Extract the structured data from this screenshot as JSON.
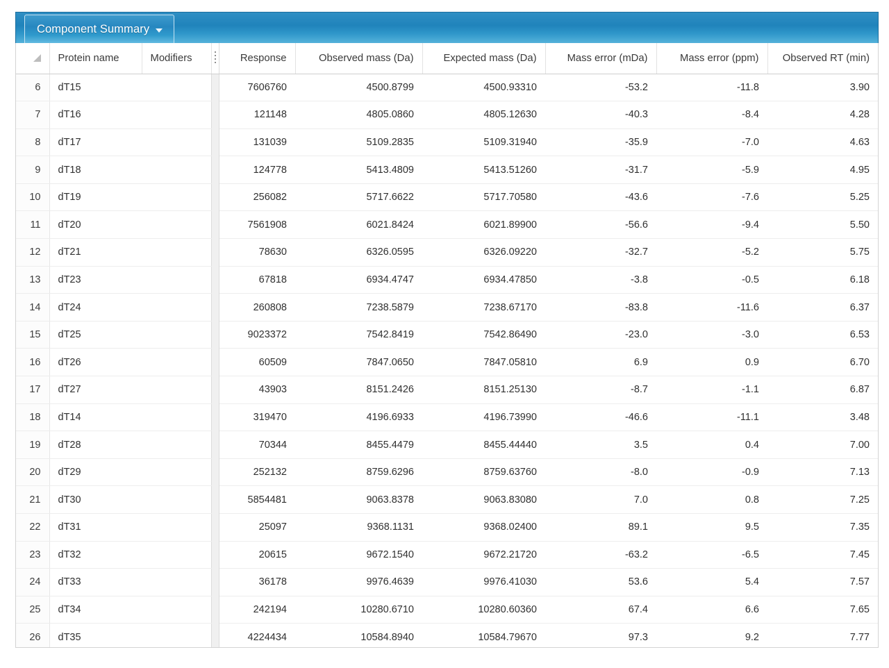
{
  "tab": {
    "label": "Component Summary",
    "caret_icon": "chevron-down-icon"
  },
  "grid": {
    "corner_icon": "select-all-triangle-icon",
    "splitter_icon": "column-grip-icon",
    "columns": [
      "Protein name",
      "Modifiers",
      "Response",
      "Observed mass (Da)",
      "Expected mass (Da)",
      "Mass error (mDa)",
      "Mass error (ppm)",
      "Observed RT (min)"
    ],
    "rows": [
      {
        "n": "6",
        "protein": "dT15",
        "mods": "",
        "response": "7606760",
        "observed": "4500.8799",
        "expected": "4500.93310",
        "mda": "-53.2",
        "ppm": "-11.8",
        "rt": "3.90"
      },
      {
        "n": "7",
        "protein": "dT16",
        "mods": "",
        "response": "121148",
        "observed": "4805.0860",
        "expected": "4805.12630",
        "mda": "-40.3",
        "ppm": "-8.4",
        "rt": "4.28"
      },
      {
        "n": "8",
        "protein": "dT17",
        "mods": "",
        "response": "131039",
        "observed": "5109.2835",
        "expected": "5109.31940",
        "mda": "-35.9",
        "ppm": "-7.0",
        "rt": "4.63"
      },
      {
        "n": "9",
        "protein": "dT18",
        "mods": "",
        "response": "124778",
        "observed": "5413.4809",
        "expected": "5413.51260",
        "mda": "-31.7",
        "ppm": "-5.9",
        "rt": "4.95"
      },
      {
        "n": "10",
        "protein": "dT19",
        "mods": "",
        "response": "256082",
        "observed": "5717.6622",
        "expected": "5717.70580",
        "mda": "-43.6",
        "ppm": "-7.6",
        "rt": "5.25"
      },
      {
        "n": "11",
        "protein": "dT20",
        "mods": "",
        "response": "7561908",
        "observed": "6021.8424",
        "expected": "6021.89900",
        "mda": "-56.6",
        "ppm": "-9.4",
        "rt": "5.50"
      },
      {
        "n": "12",
        "protein": "dT21",
        "mods": "",
        "response": "78630",
        "observed": "6326.0595",
        "expected": "6326.09220",
        "mda": "-32.7",
        "ppm": "-5.2",
        "rt": "5.75"
      },
      {
        "n": "13",
        "protein": "dT23",
        "mods": "",
        "response": "67818",
        "observed": "6934.4747",
        "expected": "6934.47850",
        "mda": "-3.8",
        "ppm": "-0.5",
        "rt": "6.18"
      },
      {
        "n": "14",
        "protein": "dT24",
        "mods": "",
        "response": "260808",
        "observed": "7238.5879",
        "expected": "7238.67170",
        "mda": "-83.8",
        "ppm": "-11.6",
        "rt": "6.37"
      },
      {
        "n": "15",
        "protein": "dT25",
        "mods": "",
        "response": "9023372",
        "observed": "7542.8419",
        "expected": "7542.86490",
        "mda": "-23.0",
        "ppm": "-3.0",
        "rt": "6.53"
      },
      {
        "n": "16",
        "protein": "dT26",
        "mods": "",
        "response": "60509",
        "observed": "7847.0650",
        "expected": "7847.05810",
        "mda": "6.9",
        "ppm": "0.9",
        "rt": "6.70"
      },
      {
        "n": "17",
        "protein": "dT27",
        "mods": "",
        "response": "43903",
        "observed": "8151.2426",
        "expected": "8151.25130",
        "mda": "-8.7",
        "ppm": "-1.1",
        "rt": "6.87"
      },
      {
        "n": "18",
        "protein": "dT14",
        "mods": "",
        "response": "319470",
        "observed": "4196.6933",
        "expected": "4196.73990",
        "mda": "-46.6",
        "ppm": "-11.1",
        "rt": "3.48"
      },
      {
        "n": "19",
        "protein": "dT28",
        "mods": "",
        "response": "70344",
        "observed": "8455.4479",
        "expected": "8455.44440",
        "mda": "3.5",
        "ppm": "0.4",
        "rt": "7.00"
      },
      {
        "n": "20",
        "protein": "dT29",
        "mods": "",
        "response": "252132",
        "observed": "8759.6296",
        "expected": "8759.63760",
        "mda": "-8.0",
        "ppm": "-0.9",
        "rt": "7.13"
      },
      {
        "n": "21",
        "protein": "dT30",
        "mods": "",
        "response": "5854481",
        "observed": "9063.8378",
        "expected": "9063.83080",
        "mda": "7.0",
        "ppm": "0.8",
        "rt": "7.25"
      },
      {
        "n": "22",
        "protein": "dT31",
        "mods": "",
        "response": "25097",
        "observed": "9368.1131",
        "expected": "9368.02400",
        "mda": "89.1",
        "ppm": "9.5",
        "rt": "7.35"
      },
      {
        "n": "23",
        "protein": "dT32",
        "mods": "",
        "response": "20615",
        "observed": "9672.1540",
        "expected": "9672.21720",
        "mda": "-63.2",
        "ppm": "-6.5",
        "rt": "7.45"
      },
      {
        "n": "24",
        "protein": "dT33",
        "mods": "",
        "response": "36178",
        "observed": "9976.4639",
        "expected": "9976.41030",
        "mda": "53.6",
        "ppm": "5.4",
        "rt": "7.57"
      },
      {
        "n": "25",
        "protein": "dT34",
        "mods": "",
        "response": "242194",
        "observed": "10280.6710",
        "expected": "10280.60360",
        "mda": "67.4",
        "ppm": "6.6",
        "rt": "7.65"
      },
      {
        "n": "26",
        "protein": "dT35",
        "mods": "",
        "response": "4224434",
        "observed": "10584.8940",
        "expected": "10584.79670",
        "mda": "97.3",
        "ppm": "9.2",
        "rt": "7.77"
      }
    ]
  },
  "colors": {
    "tab_accent": "#2083bb",
    "grid_border": "#d3d3d3",
    "row_line": "#ededed",
    "text": "#303030"
  }
}
